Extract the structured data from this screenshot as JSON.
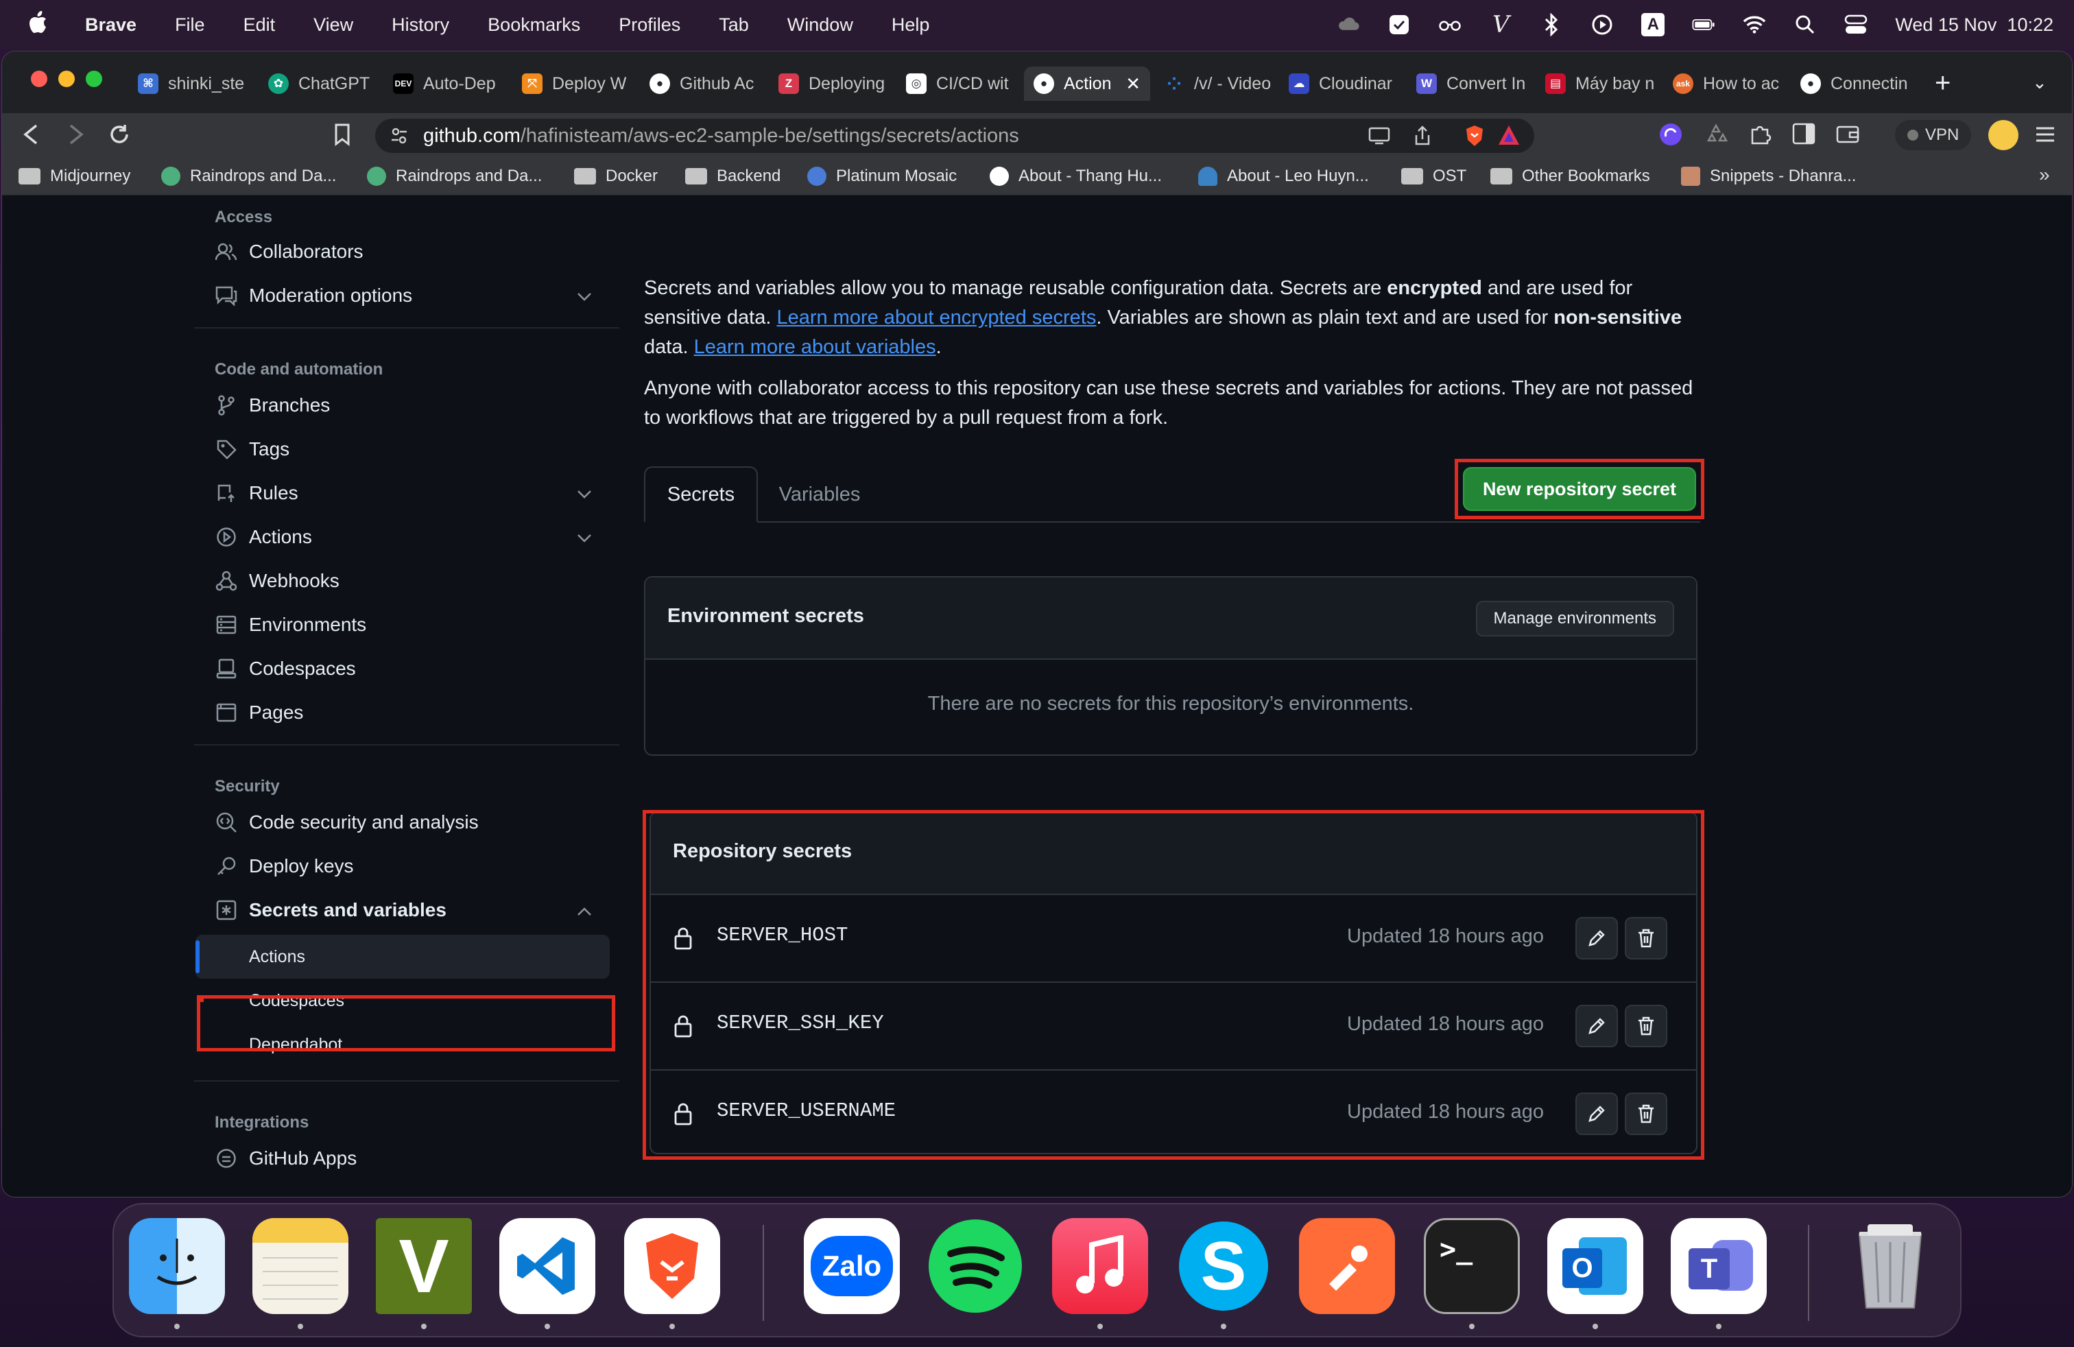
{
  "menubar": {
    "app": "Brave",
    "items": [
      "File",
      "Edit",
      "View",
      "History",
      "Bookmarks",
      "Profiles",
      "Tab",
      "Window",
      "Help"
    ],
    "clock": "Wed 15 Nov  10:22",
    "input_letter": "A"
  },
  "tabs": [
    {
      "label": "shinki_ste",
      "color": "#3b6fd1"
    },
    {
      "label": "ChatGPT",
      "color": "#10a37f"
    },
    {
      "label": "Auto-Dep",
      "color": "#000000",
      "favtext": "DEV"
    },
    {
      "label": "Deploy W",
      "color": "#f28b1e"
    },
    {
      "label": "Github Ac",
      "color": "#24292f"
    },
    {
      "label": "Deploying",
      "color": "#d63a4e"
    },
    {
      "label": "CI/CD wit",
      "color": "#555555"
    },
    {
      "label": "Action",
      "color": "#24292f",
      "active": true
    },
    {
      "label": "/v/ - Video",
      "color": "#2b7de9"
    },
    {
      "label": "Cloudinar",
      "color": "#3448c5"
    },
    {
      "label": "Convert In",
      "color": "#5b5bd6"
    },
    {
      "label": "Máy bay n",
      "color": "#c8102e"
    },
    {
      "label": "How to ac",
      "color": "#e56b2e"
    },
    {
      "label": "Connectin",
      "color": "#24292f"
    }
  ],
  "toolbar": {
    "url_host": "github.com",
    "url_path": "/hafinisteam/aws-ec2-sample-be/settings/secrets/actions",
    "vpn": "VPN"
  },
  "bookmarks": [
    "Midjourney",
    "Raindrops and Da...",
    "Raindrops and Da...",
    "Docker",
    "Backend",
    "Platinum Mosaic",
    "About - Thang Hu...",
    "About - Leo Huyn...",
    "OST",
    "Other Bookmarks",
    "Snippets - Dhanra..."
  ],
  "sidebar": {
    "access_heading": "Access",
    "access": [
      "Collaborators",
      "Moderation options"
    ],
    "code_heading": "Code and automation",
    "code": [
      "Branches",
      "Tags",
      "Rules",
      "Actions",
      "Webhooks",
      "Environments",
      "Codespaces",
      "Pages"
    ],
    "security_heading": "Security",
    "security": [
      "Code security and analysis",
      "Deploy keys",
      "Secrets and variables"
    ],
    "secrets_sub": [
      "Actions",
      "Codespaces",
      "Dependabot"
    ],
    "integrations_heading": "Integrations",
    "integrations": [
      "GitHub Apps"
    ]
  },
  "main": {
    "intro_1a": "Secrets and variables allow you to manage reusable configuration data. Secrets are ",
    "intro_1b": "encrypted",
    "intro_1c": " and are used for sensitive data. ",
    "intro_link1": "Learn more about encrypted secrets",
    "intro_1d": ". Variables are shown as plain text and are used for ",
    "intro_1e": "non-sensitive",
    "intro_1f": " data. ",
    "intro_link2": "Learn more about variables",
    "intro_1g": ".",
    "intro_2": "Anyone with collaborator access to this repository can use these secrets and variables for actions. They are not passed to workflows that are triggered by a pull request from a fork.",
    "tab_secrets": "Secrets",
    "tab_variables": "Variables",
    "new_secret_button": "New repository secret",
    "env_title": "Environment secrets",
    "manage_env_button": "Manage environments",
    "env_empty": "There are no secrets for this repository’s environments.",
    "repo_title": "Repository secrets",
    "secrets": [
      {
        "name": "SERVER_HOST",
        "updated": "Updated 18 hours ago"
      },
      {
        "name": "SERVER_SSH_KEY",
        "updated": "Updated 18 hours ago"
      },
      {
        "name": "SERVER_USERNAME",
        "updated": "Updated 18 hours ago"
      }
    ]
  },
  "dock": {
    "apps": [
      "finder-icon",
      "notes-icon",
      "vim-icon",
      "vscode-icon",
      "brave-icon",
      "zalo-icon",
      "spotify-icon",
      "music-icon",
      "skype-icon",
      "postman-icon",
      "terminal-icon",
      "outlook-icon",
      "teams-icon",
      "trash-icon"
    ],
    "zalo_label": "Zalo",
    "vim_label": "V",
    "skype_label": "S",
    "outlook_label": "O",
    "teams_label": "T",
    "terminal_label": ">_"
  }
}
